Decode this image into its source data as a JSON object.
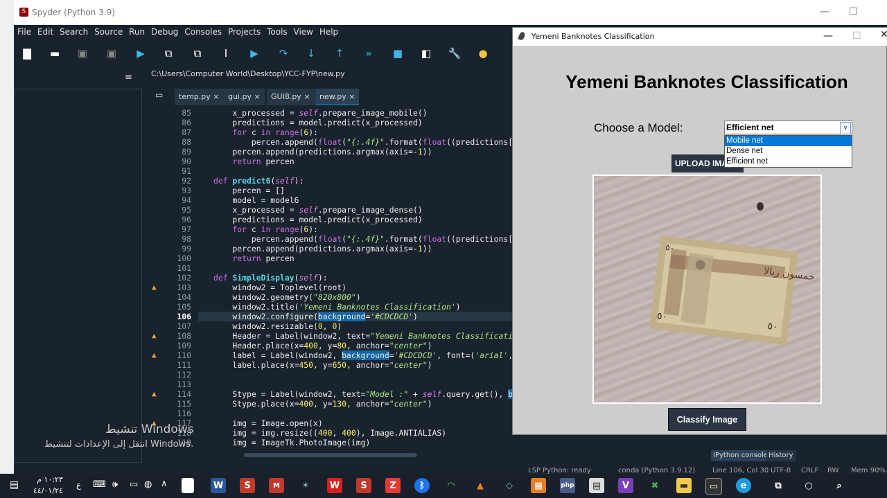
{
  "spyder": {
    "title": "Spyder (Python 3.9)",
    "menu": [
      "File",
      "Edit",
      "Search",
      "Source",
      "Run",
      "Debug",
      "Consoles",
      "Projects",
      "Tools",
      "View",
      "Help"
    ],
    "toolbar_icons": [
      "new-file-icon",
      "open-file-icon",
      "save-icon",
      "save-all-icon",
      "run-icon",
      "run-cell-icon",
      "run-cell-advance-icon",
      "run-selection-icon",
      "debug-icon",
      "step-icon",
      "step-into-icon",
      "step-out-icon",
      "continue-icon",
      "stop-icon",
      "maximize-pane-icon",
      "preferences-icon",
      "python-path-icon"
    ],
    "path": "C:\\Users\\Computer World\\Desktop\\YCC-FYP\\new.py",
    "tabs": [
      {
        "label": "temp.py",
        "close": "×"
      },
      {
        "label": "gui.py",
        "close": "×"
      },
      {
        "label": "GUI8.py",
        "close": "×"
      },
      {
        "label": "new.py",
        "close": "×"
      }
    ],
    "current_line": 106,
    "status": {
      "lsp": "LSP Python: ready",
      "env": "conda (Python 3.9.12)",
      "position": "Line 106, Col 30",
      "encoding": "UTF-8",
      "eol": "CRLF",
      "rw": "RW",
      "mem": "Mem 90%"
    },
    "console_tabs": [
      "IPython console",
      "History"
    ],
    "watermark_title": "تنشيط Windows",
    "watermark_sub": "انتقل إلى الإعدادات لتنشيط Windows."
  },
  "tk_window": {
    "title": "Yemeni Banknotes Classification",
    "heading": "Yemeni Banknotes Classification",
    "choose_label": "Choose a Model:",
    "combo_value": "Efficient net",
    "options": [
      "Mobile net",
      "Dense net",
      "Efficient net"
    ],
    "selected_option": "Mobile net",
    "upload_button": "UPLOAD IMAGE",
    "classify_button": "Classify Image"
  },
  "taskbar": {
    "time": "١٠:٢٣ م",
    "date": "٤٤/٠١/٢٤",
    "lang": "ع",
    "apps": [
      "file-explorer-icon",
      "word-icon",
      "spyder-icon",
      "mcafee-icon",
      "network-icon",
      "wps-icon",
      "spyder-icon",
      "pdf-icon",
      "bluetooth-icon",
      "wifi-icon",
      "matlab-icon",
      "virtualbox-icon",
      "office-icon",
      "php-icon",
      "sql-icon",
      "visual-studio-icon",
      "anaconda-icon",
      "folder-icon",
      "terminal-icon",
      "edge-icon",
      "task-view-icon",
      "cortana-icon",
      "search-icon"
    ]
  }
}
